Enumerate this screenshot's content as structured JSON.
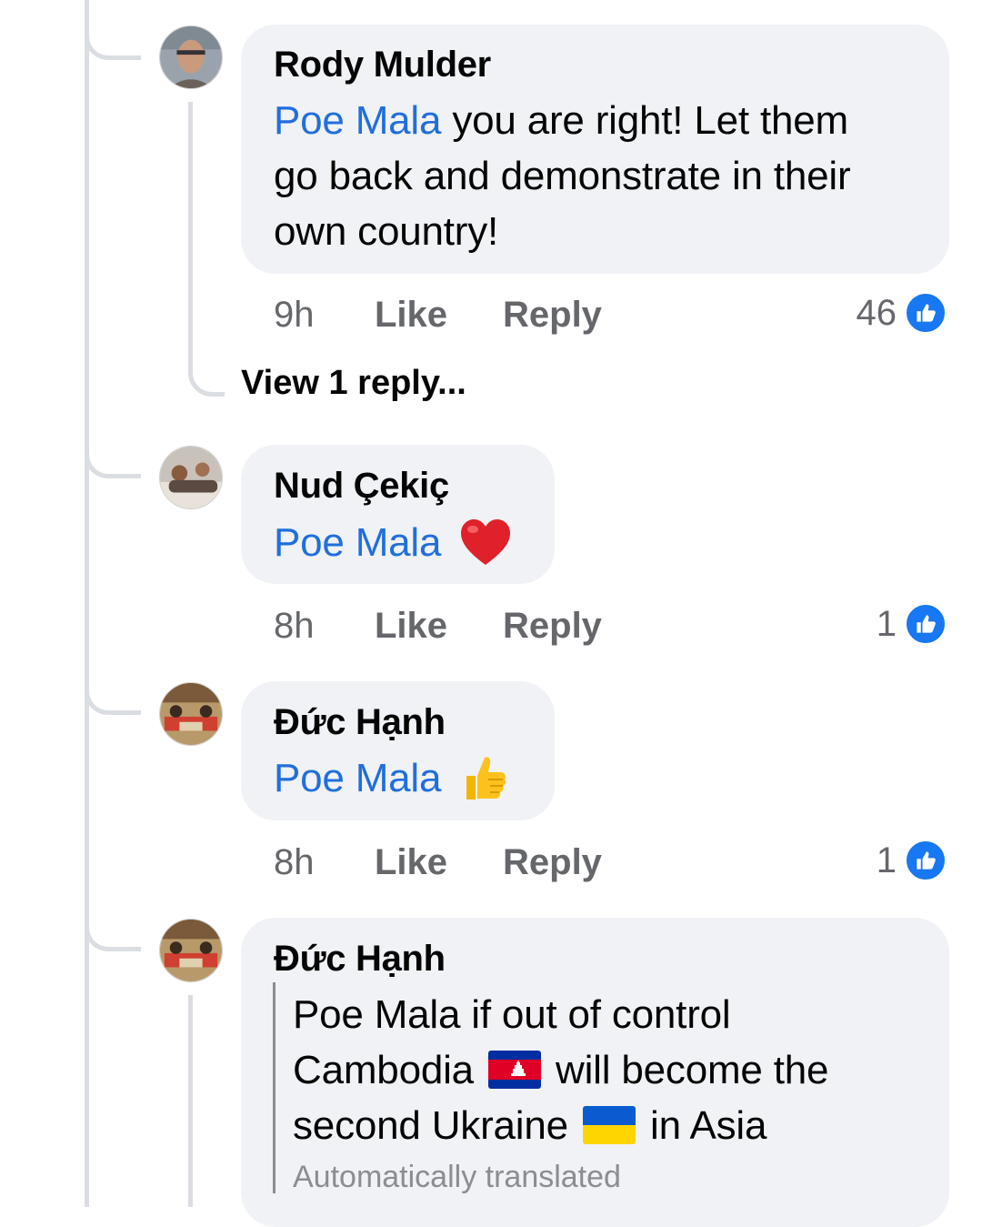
{
  "comments": [
    {
      "author": "Rody Mulder",
      "mention": "Poe Mala",
      "text_line1": "you are right! Let them",
      "text_line2": "go back and demonstrate in their",
      "text_line3": "own country!",
      "time": "9h",
      "like_label": "Like",
      "reply_label": "Reply",
      "reaction_count": "46",
      "view_replies": "View 1 reply..."
    },
    {
      "author": "Nud Çekiç",
      "mention": "Poe Mala",
      "emoji": "heart-emoji",
      "time": "8h",
      "like_label": "Like",
      "reply_label": "Reply",
      "reaction_count": "1"
    },
    {
      "author": "Đức Hạnh",
      "mention": "Poe Mala",
      "emoji": "thumbs-up-emoji",
      "time": "8h",
      "like_label": "Like",
      "reply_label": "Reply",
      "reaction_count": "1"
    },
    {
      "author": "Đức Hạnh",
      "text_line1": "Poe Mala if out of control",
      "text_line2_a": "Cambodia",
      "text_line2_b": "will become the",
      "text_line3_a": "second Ukraine",
      "text_line3_b": "in Asia",
      "translation_note": "Automatically translated"
    }
  ],
  "colors": {
    "mention": "#216fdb",
    "bubble": "#f0f2f5",
    "like_badge": "#1877f2",
    "meta_text": "#65676b"
  }
}
